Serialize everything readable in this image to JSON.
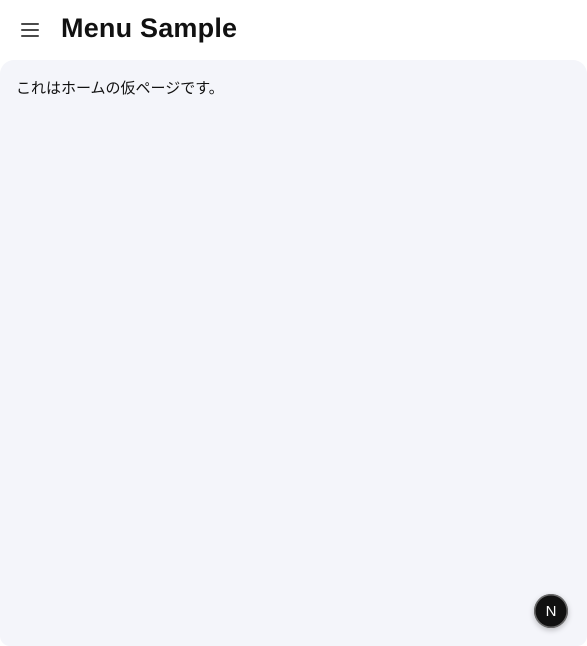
{
  "header": {
    "title": "Menu Sample",
    "menu_icon": "hamburger-menu-icon"
  },
  "main": {
    "text": "これはホームの仮ページです。"
  },
  "dev_badge": {
    "label": "N",
    "icon": "nextjs-logo-icon"
  }
}
